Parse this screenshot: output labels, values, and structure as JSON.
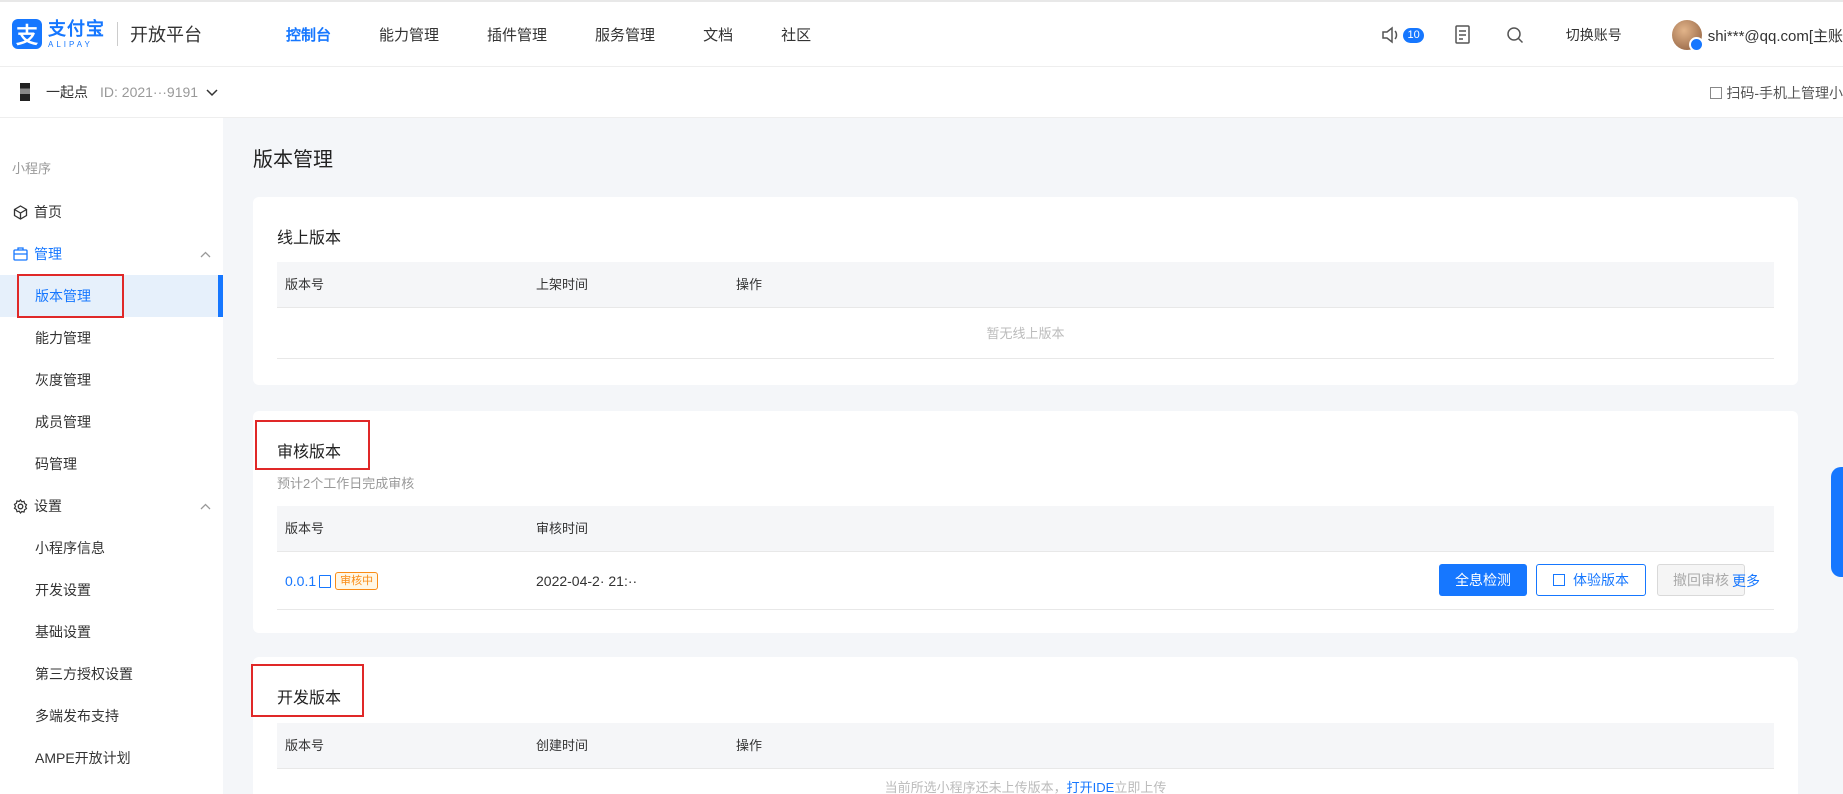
{
  "topnav": {
    "logo_cn": "支付宝",
    "logo_en": "ALIPAY",
    "platform": "开放平台",
    "items": [
      {
        "label": "控制台",
        "active": true
      },
      {
        "label": "能力管理",
        "active": false
      },
      {
        "label": "插件管理",
        "active": false
      },
      {
        "label": "服务管理",
        "active": false
      },
      {
        "label": "文档",
        "active": false
      },
      {
        "label": "社区",
        "active": false
      }
    ],
    "notification_count": "10",
    "switch_account": "切换账号",
    "account": "shi***@qq.com[主账"
  },
  "appbar": {
    "app_name": "一起点",
    "app_id": "ID: 2021···9191",
    "scan_label": "扫码-手机上管理小"
  },
  "sidebar": {
    "category": "小程序",
    "home": "首页",
    "manage_group": "管理",
    "manage_items": [
      "版本管理",
      "能力管理",
      "灰度管理",
      "成员管理",
      "码管理"
    ],
    "settings_group": "设置",
    "settings_items": [
      "小程序信息",
      "开发设置",
      "基础设置",
      "第三方授权设置",
      "多端发布支持",
      "AMPE开放计划"
    ]
  },
  "main": {
    "title": "版本管理",
    "online": {
      "title": "线上版本",
      "columns": [
        "版本号",
        "上架时间",
        "操作"
      ],
      "empty_text": "暂无线上版本"
    },
    "review": {
      "title": "审核版本",
      "subtitle": "预计2个工作日完成审核",
      "columns": [
        "版本号",
        "审核时间"
      ],
      "row": {
        "version": "0.0.1",
        "status": "审核中",
        "time": "2022-04-2· 21:··"
      },
      "actions": {
        "check": "全息检测",
        "trial": "体验版本",
        "withdraw": "撤回审核",
        "more": "更多"
      }
    },
    "dev": {
      "title": "开发版本",
      "columns": [
        "版本号",
        "创建时间",
        "操作"
      ],
      "hint_prefix": "当前所选小程序还未上传版本，",
      "hint_link": "打开IDE",
      "hint_suffix": "立即上传"
    }
  },
  "colors": {
    "primary": "#1677ff",
    "highlight_box": "#e02828",
    "review_tag": "#fa8c16"
  }
}
